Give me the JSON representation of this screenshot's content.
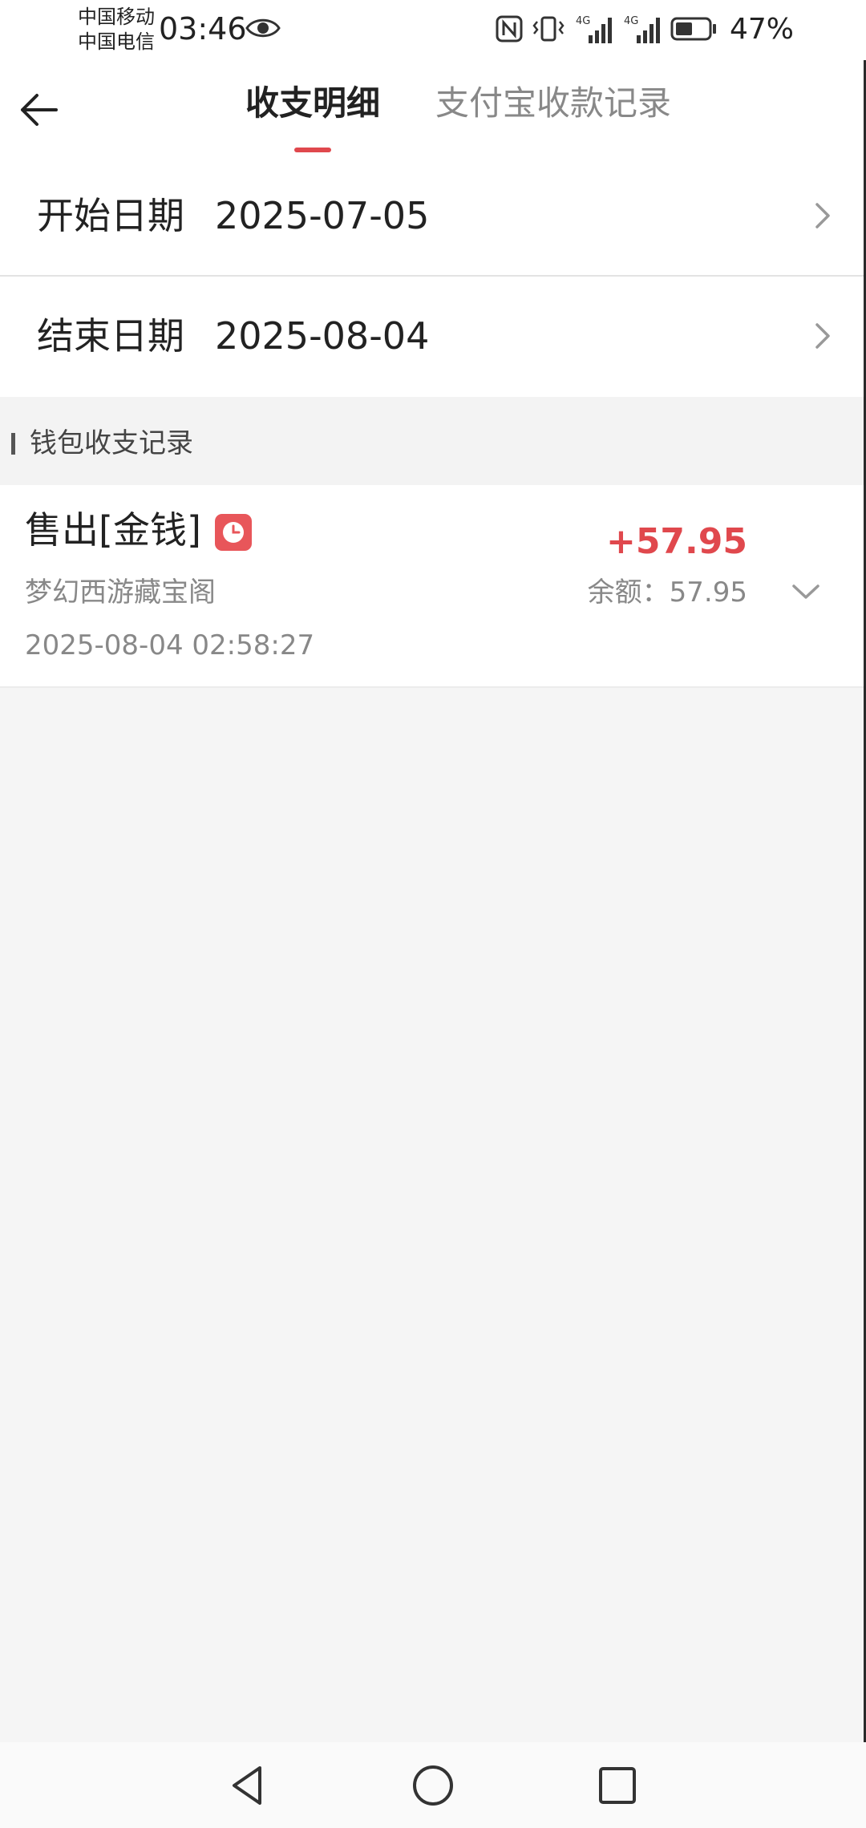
{
  "status_bar": {
    "carrier_1": "中国移动",
    "carrier_2": "中国电信",
    "time": "03:46",
    "network_1": "4G",
    "network_2": "4G",
    "battery": "47%"
  },
  "header": {
    "tabs": [
      {
        "label": "收支明细",
        "active": true
      },
      {
        "label": "支付宝收款记录",
        "active": false
      }
    ]
  },
  "filters": {
    "start_label": "开始日期",
    "start_value": "2025-07-05",
    "end_label": "结束日期",
    "end_value": "2025-08-04"
  },
  "section": {
    "title": "钱包收支记录"
  },
  "records": [
    {
      "title": "售出[金钱]",
      "source": "梦幻西游藏宝阁",
      "time": "2025-08-04 02:58:27",
      "amount": "+57.95",
      "balance": "余额：57.95"
    }
  ],
  "colors": {
    "accent": "#e0484d",
    "badge": "#e8565a",
    "muted_text": "#888888"
  },
  "icons": {
    "back": "arrow-left-icon",
    "visibility": "eye-icon",
    "nfc": "nfc-icon",
    "vibrate": "vibrate-icon",
    "badge": "clock-icon",
    "expand": "chevron-down-icon"
  }
}
